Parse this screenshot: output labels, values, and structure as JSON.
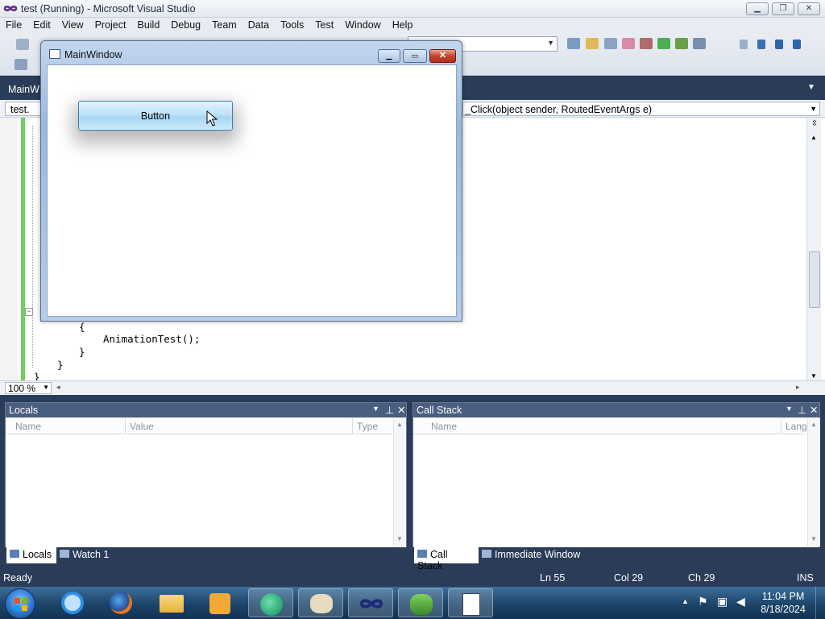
{
  "app": {
    "title": "test (Running) - Microsoft Visual Studio",
    "caption_minimize": "▁",
    "caption_maximize": "❐",
    "caption_close": "✕"
  },
  "menu": [
    "File",
    "Edit",
    "View",
    "Project",
    "Build",
    "Debug",
    "Team",
    "Data",
    "Tools",
    "Test",
    "Window",
    "Help"
  ],
  "doc_tab": {
    "label": "MainW"
  },
  "navbar": {
    "left": "test.",
    "right": "_Click(object sender, RoutedEventArgs e)"
  },
  "code": {
    "line1": "{",
    "line2": "AnimationTest();",
    "line3": "}",
    "line4": "}",
    "line5": "}"
  },
  "zoom": "100 %",
  "locals": {
    "title": "Locals",
    "columns": [
      "Name",
      "Value",
      "Type"
    ],
    "tabs": [
      "Locals",
      "Watch 1"
    ]
  },
  "callstack": {
    "title": "Call Stack",
    "columns": [
      "Name",
      "Lang"
    ],
    "tabs": [
      "Call Stack",
      "Immediate Window"
    ]
  },
  "status": {
    "text": "Ready",
    "ln": "Ln 55",
    "col": "Col 29",
    "ch": "Ch 29",
    "mode": "INS"
  },
  "main_window": {
    "title": "MainWindow",
    "button_label": "Button"
  },
  "taskbar": {
    "time": "11:04 PM",
    "date": "8/18/2024",
    "apps": [
      "internet-explorer-icon",
      "firefox-icon",
      "explorer-icon",
      "media-player-icon",
      "blend-icon",
      "paint-icon",
      "visual-studio-icon",
      "users-icon",
      "notepad-icon"
    ]
  },
  "colors": {
    "vs_chrome": "#2b3c59",
    "panel_header": "#4a5e80",
    "change_bar": "#6bd25f"
  }
}
